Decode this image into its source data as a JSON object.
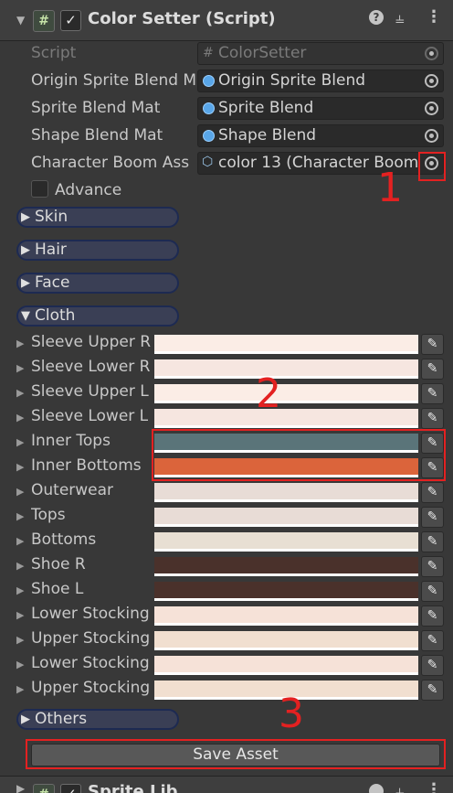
{
  "header": {
    "title": "Color Setter (Script)",
    "collapse_icon": "triangle-down-icon",
    "script_icon": "hash",
    "help_icon": "?",
    "settings_icon": "⊏",
    "more_icon": "⋮"
  },
  "fields": [
    {
      "label": "Script",
      "value": "ColorSetter",
      "disabled": true
    },
    {
      "label": "Origin Sprite Blend M",
      "value": "Origin Sprite Blend"
    },
    {
      "label": "Sprite Blend Mat",
      "value": "Sprite Blend"
    },
    {
      "label": "Shape Blend Mat",
      "value": "Shape Blend"
    },
    {
      "label": "Character Boom Ass",
      "value": "color 13 (Character Boom"
    }
  ],
  "advance": {
    "label": "Advance"
  },
  "foldouts": {
    "skin": "Skin",
    "hair": "Hair",
    "face": "Face",
    "cloth": "Cloth",
    "others": "Others"
  },
  "colors": [
    {
      "label": "Sleeve Upper R",
      "color": "#fbede6"
    },
    {
      "label": "Sleeve Lower R",
      "color": "#f6e6e0"
    },
    {
      "label": "Sleeve Upper L",
      "color": "#fbede6"
    },
    {
      "label": "Sleeve Lower L",
      "color": "#f6e6e0"
    },
    {
      "label": "Inner Tops",
      "color": "#5a7479"
    },
    {
      "label": "Inner Bottoms",
      "color": "#db643b"
    },
    {
      "label": "Outerwear",
      "color": "#e8dcd6"
    },
    {
      "label": "Tops",
      "color": "#e8dcd6"
    },
    {
      "label": "Bottoms",
      "color": "#e8dfd3"
    },
    {
      "label": "Shoe R",
      "color": "#4a312b"
    },
    {
      "label": "Shoe L",
      "color": "#4a312b"
    },
    {
      "label": "Lower Stocking",
      "color": "#f6e2d8"
    },
    {
      "label": "Upper Stocking",
      "color": "#f1dfd0"
    },
    {
      "label": "Lower Stocking",
      "color": "#f6e2d8"
    },
    {
      "label": "Upper Stocking",
      "color": "#f1dfd0"
    }
  ],
  "save_label": "Save Asset",
  "annotations": [
    "1",
    "2",
    "3"
  ],
  "next_component": "Sprite Lib"
}
